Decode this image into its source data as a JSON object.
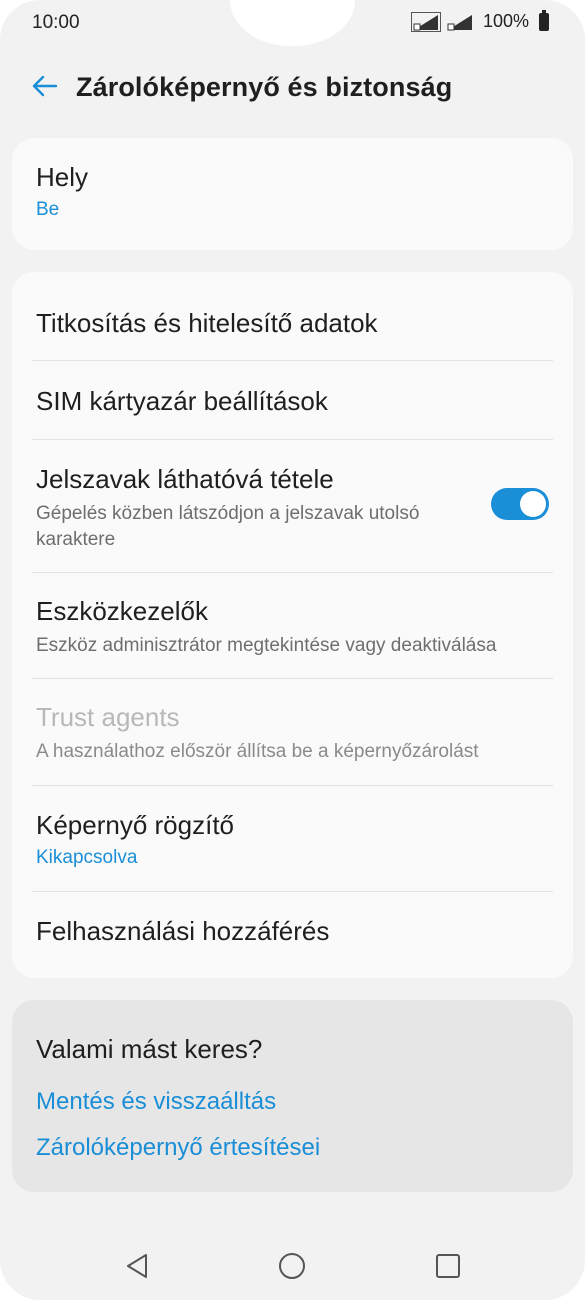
{
  "status_bar": {
    "time": "10:00",
    "battery": "100%"
  },
  "app_bar": {
    "title": "Zárolóképernyő és biztonság",
    "back_icon": "arrow-left-icon"
  },
  "location": {
    "title": "Hely",
    "value": "Be"
  },
  "settings": [
    {
      "title": "Titkosítás és hitelesítő adatok"
    },
    {
      "title": "SIM kártyazár beállítások"
    },
    {
      "title": "Jelszavak láthatóvá tétele",
      "subtitle": "Gépelés közben látszódjon a jelszavak utolsó karaktere",
      "toggle_on": true
    },
    {
      "title": "Eszközkezelők",
      "subtitle": "Eszköz adminisztrátor megtekintése vagy deaktiválása"
    },
    {
      "title": "Trust agents",
      "subtitle": "A használathoz először állítsa be a képernyőzárolást",
      "disabled": true
    },
    {
      "title": "Képernyő rögzítő",
      "value": "Kikapcsolva"
    },
    {
      "title": "Felhasználási hozzáférés"
    }
  ],
  "suggestions": {
    "title": "Valami mást keres?",
    "links": [
      "Mentés és visszaálltás",
      "Zárolóképernyő értesítései"
    ]
  },
  "nav_bar": {
    "back_icon": "triangle-back-icon",
    "home_icon": "circle-home-icon",
    "recents_icon": "square-recents-icon"
  },
  "colors": {
    "accent": "#1a8ed6",
    "background": "#f2f2f2",
    "card": "#fafafa"
  }
}
